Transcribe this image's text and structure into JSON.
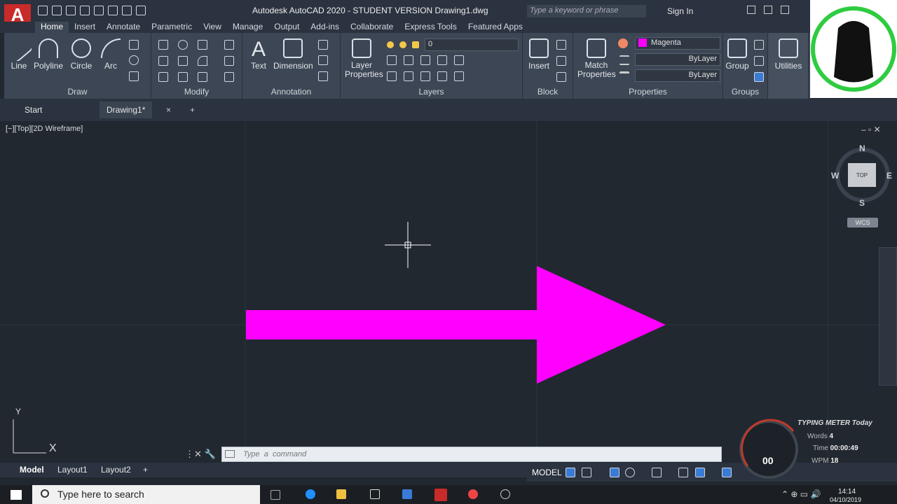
{
  "app": {
    "logo": "A",
    "title": "Autodesk AutoCAD 2020 - STUDENT VERSION   Drawing1.dwg",
    "search_placeholder": "Type a keyword or phrase",
    "sign_in": "Sign In",
    "accent": "#c92a2a"
  },
  "ribbon_tabs": [
    "Home",
    "Insert",
    "Annotate",
    "Parametric",
    "View",
    "Manage",
    "Output",
    "Add-ins",
    "Collaborate",
    "Express Tools",
    "Featured Apps"
  ],
  "draw": {
    "label": "Draw",
    "tools": [
      "Line",
      "Polyline",
      "Circle",
      "Arc"
    ]
  },
  "modify": {
    "label": "Modify"
  },
  "annotation": {
    "label": "Annotation",
    "text": "Text",
    "dimension": "Dimension"
  },
  "layers": {
    "label": "Layers",
    "layer_properties": "Layer\nProperties",
    "current_layer": "0"
  },
  "block": {
    "label": "Block",
    "insert": "Insert"
  },
  "properties": {
    "label": "Properties",
    "match": "Match\nProperties",
    "color": "Magenta",
    "linetype": "ByLayer",
    "lineweight": "ByLayer",
    "color_hex": "#ff00ff"
  },
  "groups": {
    "label": "Groups",
    "group": "Group"
  },
  "utilities": {
    "label": "Utilities"
  },
  "file_tabs": {
    "start": "Start",
    "drawing": "Drawing1*",
    "close": "×",
    "add": "+"
  },
  "viewport": {
    "label": "[−][Top][2D Wireframe]",
    "cube_face": "TOP",
    "n": "N",
    "s": "S",
    "e": "E",
    "w": "W",
    "wcs": "WCS"
  },
  "ucs": {
    "y": "Y",
    "x": "X"
  },
  "command": {
    "placeholder": "Type  a  command"
  },
  "layout_tabs": [
    "Model",
    "Layout1",
    "Layout2"
  ],
  "status": {
    "model": "MODEL"
  },
  "typing_meter": {
    "title": "TYPING METER Today",
    "words_label": "Words",
    "words": "4",
    "time_label": "Time",
    "time": "00:00:49",
    "wpm_label": "WPM",
    "wpm": "18",
    "gauge": "00"
  },
  "taskbar": {
    "search": "Type here to search",
    "time": "14:14",
    "date": "04/10/2019"
  },
  "arrow": {
    "color": "#ff00ff"
  }
}
